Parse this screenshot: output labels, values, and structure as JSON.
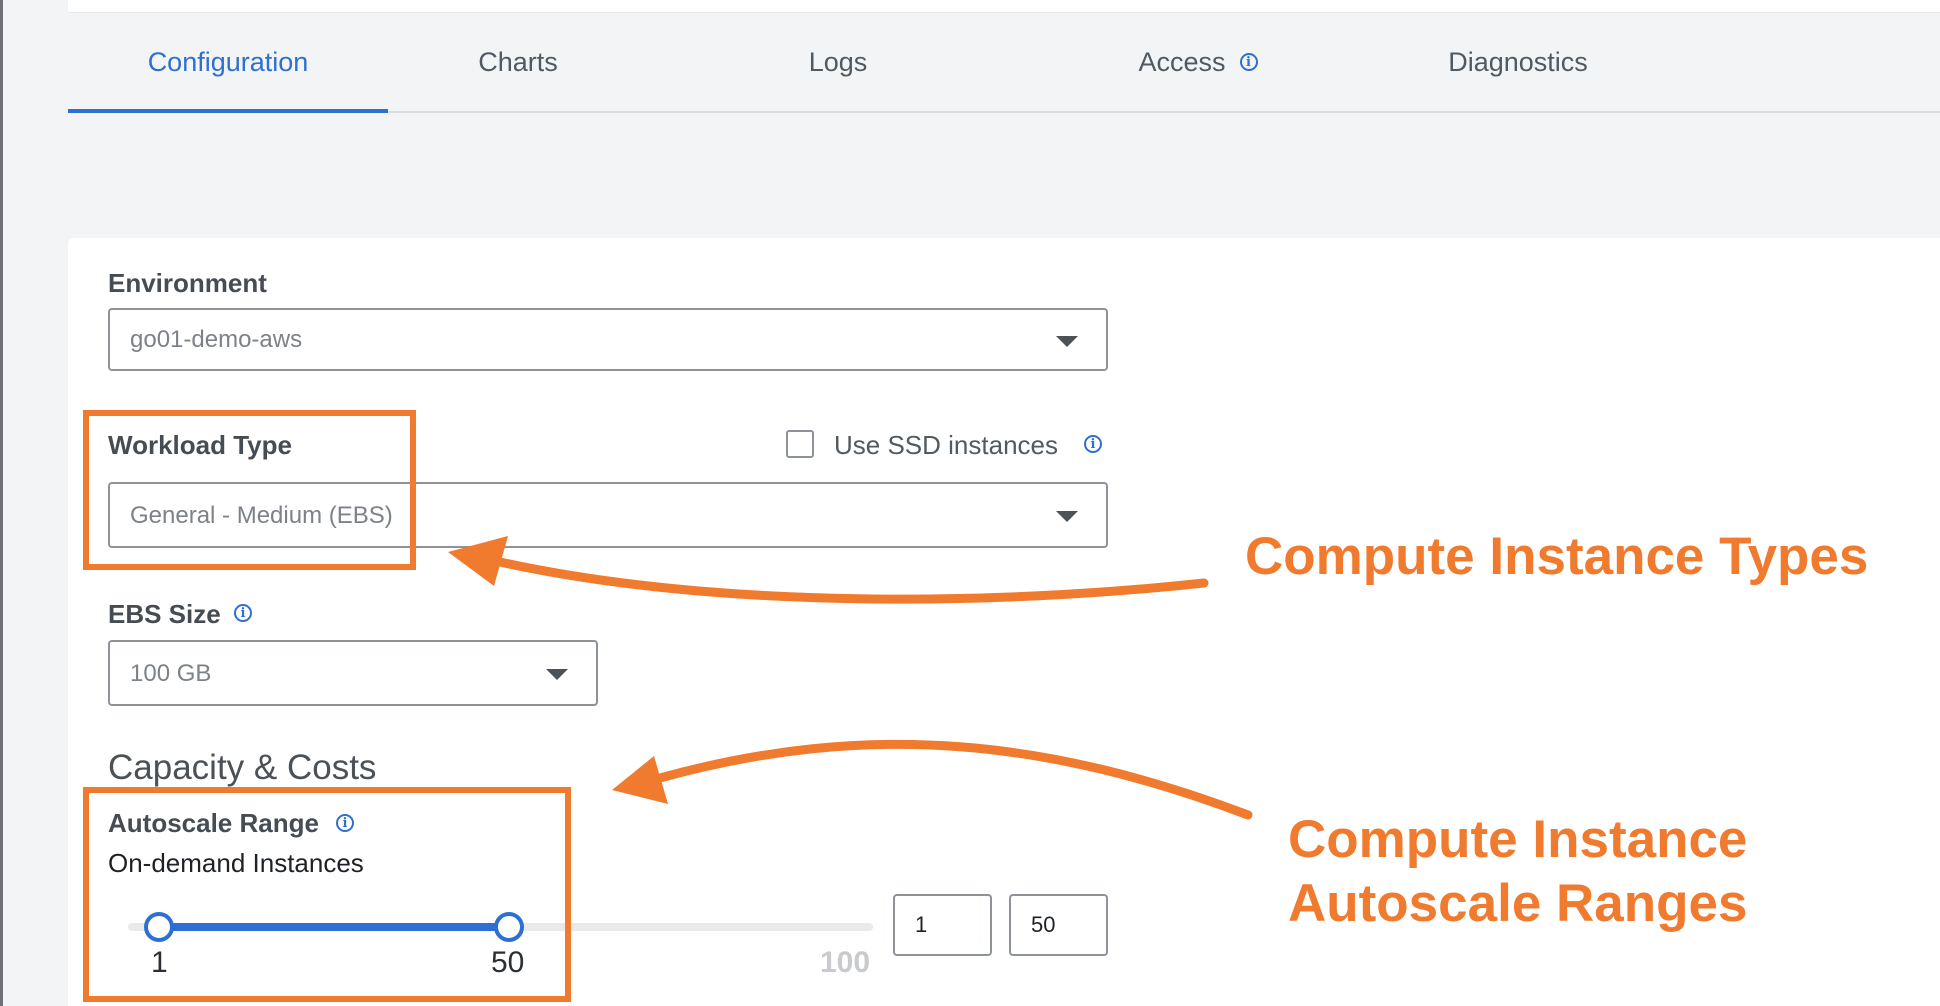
{
  "tabs": [
    {
      "label": "Configuration",
      "active": true
    },
    {
      "label": "Charts",
      "active": false
    },
    {
      "label": "Logs",
      "active": false
    },
    {
      "label": "Access",
      "active": false,
      "icon": "info-icon"
    },
    {
      "label": "Diagnostics",
      "active": false
    }
  ],
  "form": {
    "environment": {
      "label": "Environment",
      "value": "go01-demo-aws"
    },
    "workload_type": {
      "label": "Workload Type",
      "value": "General - Medium (EBS)"
    },
    "ssd": {
      "label": "Use SSD instances",
      "checked": false
    },
    "ebs_size": {
      "label": "EBS Size",
      "value": "100 GB"
    },
    "capacity_title": "Capacity & Costs",
    "autoscale": {
      "label": "Autoscale Range",
      "sublabel": "On-demand Instances",
      "min_value": "1",
      "max_value": "50",
      "range_max": "100",
      "min_input": "1",
      "max_input": "50"
    }
  },
  "annotations": {
    "instance_types": "Compute Instance Types",
    "autoscale_line1": "Compute Instance",
    "autoscale_line2": "Autoscale Ranges",
    "color": "#f07a2e"
  },
  "colors": {
    "accent": "#2e6fd4",
    "background": "#f3f4f6"
  }
}
